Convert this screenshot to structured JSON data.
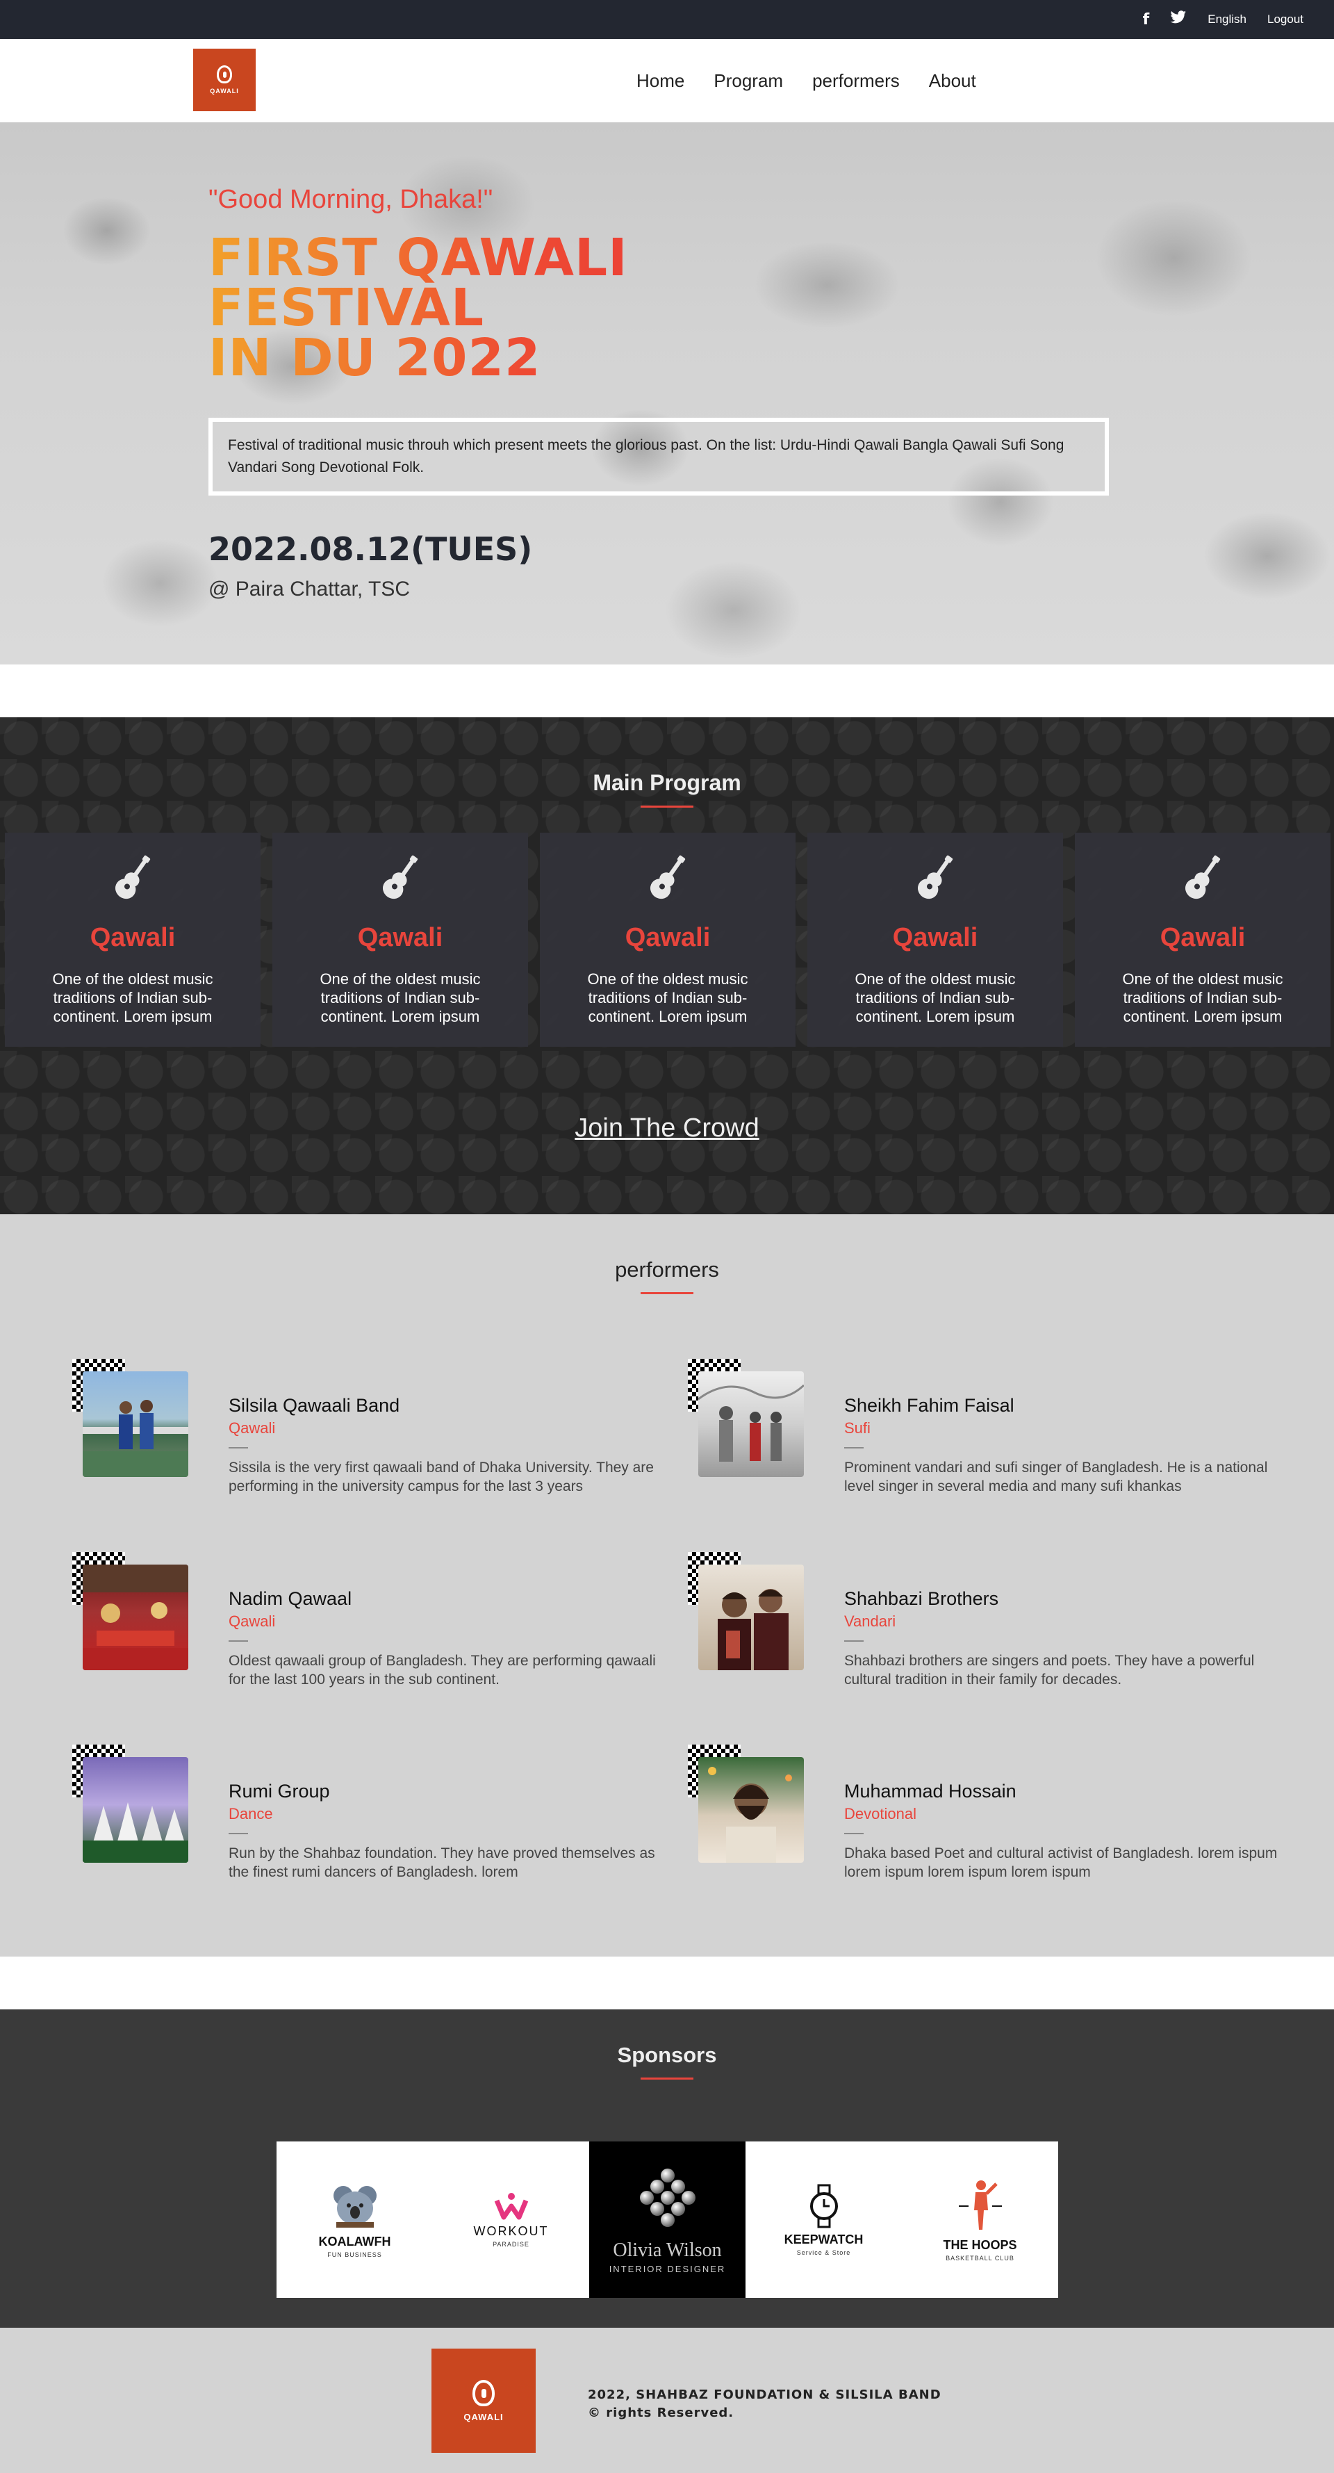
{
  "topbar": {
    "icons": [
      "facebook-icon",
      "twitter-icon"
    ],
    "facebook_glyph": "f",
    "twitter_glyph": "🐦",
    "language": "English",
    "logout": "Logout"
  },
  "brand": {
    "logo_text": "QAWALI"
  },
  "nav": {
    "items": [
      "Home",
      "Program",
      "performers",
      "About"
    ]
  },
  "hero": {
    "greeting": "\"Good Morning, Dhaka!\"",
    "title_line1": "FIRST QAWALI FESTIVAL",
    "title_line2": "IN DU 2022",
    "description": "Festival of traditional music throuh which present meets the glorious past. On the list: Urdu-Hindi Qawali Bangla Qawali Sufi Song Vandari Song Devotional Folk.",
    "date": "2022.08.12(TUES)",
    "venue": "@ Paira Chattar, TSC"
  },
  "program": {
    "title": "Main Program",
    "cards": [
      {
        "icon": "guitar-icon",
        "title": "Qawali",
        "desc": "One of the oldest music traditions of Indian sub-continent. Lorem ipsum"
      },
      {
        "icon": "guitar-icon",
        "title": "Qawali",
        "desc": "One of the oldest music traditions of Indian sub-continent. Lorem ipsum"
      },
      {
        "icon": "guitar-icon",
        "title": "Qawali",
        "desc": "One of the oldest music traditions of Indian sub-continent. Lorem ipsum"
      },
      {
        "icon": "guitar-icon",
        "title": "Qawali",
        "desc": "One of the oldest music traditions of Indian sub-continent. Lorem ipsum"
      },
      {
        "icon": "guitar-icon",
        "title": "Qawali",
        "desc": "One of the oldest music traditions of Indian sub-continent. Lorem ipsum"
      }
    ],
    "cta": "Join The Crowd"
  },
  "performers": {
    "title": "performers",
    "items": [
      {
        "name": "Silsila Qawaali Band",
        "genre": "Qawali",
        "desc": "Sissila is the very first qawaali band of Dhaka University. They are performing in the university campus for the last 3 years"
      },
      {
        "name": "Sheikh Fahim Faisal",
        "genre": "Sufi",
        "desc": "Prominent vandari and sufi singer of Bangladesh. He is a national level singer in several media and many sufi khankas"
      },
      {
        "name": "Nadim Qawaal",
        "genre": "Qawali",
        "desc": "Oldest qawaali group of Bangladesh. They are performing qawaali for the last 100 years in the sub continent."
      },
      {
        "name": "Shahbazi Brothers",
        "genre": "Vandari",
        "desc": "Shahbazi brothers are singers and poets. They have a powerful cultural tradition in their family for decades."
      },
      {
        "name": "Rumi Group",
        "genre": "Dance",
        "desc": "Run by the Shahbaz foundation. They have proved themselves as the finest rumi dancers of Bangladesh. lorem"
      },
      {
        "name": "Muhammad Hossain",
        "genre": "Devotional",
        "desc": "Dhaka based Poet and cultural activist of Bangladesh. lorem ispum lorem ispum lorem ispum lorem ispum"
      }
    ]
  },
  "sponsors": {
    "title": "Sponsors",
    "items": [
      {
        "name": "KOALAWFH",
        "tagline": "FUN BUSINESS"
      },
      {
        "name": "WORKOUT",
        "tagline": "PARADISE"
      },
      {
        "name": "Olivia Wilson",
        "tagline": "INTERIOR DESIGNER"
      },
      {
        "name": "KEEPWATCH",
        "tagline": "Service & Store"
      },
      {
        "name": "THE HOOPS",
        "tagline": "BASKETBALL CLUB"
      }
    ]
  },
  "footer": {
    "logo_text": "QAWALI",
    "line1": "2022, SHAHBAZ FOUNDATION & SILSILA BAND",
    "line2": "© rights Reserved."
  },
  "colors": {
    "accent": "#e8453c",
    "brand": "#c9461f",
    "topbar": "#232731"
  }
}
